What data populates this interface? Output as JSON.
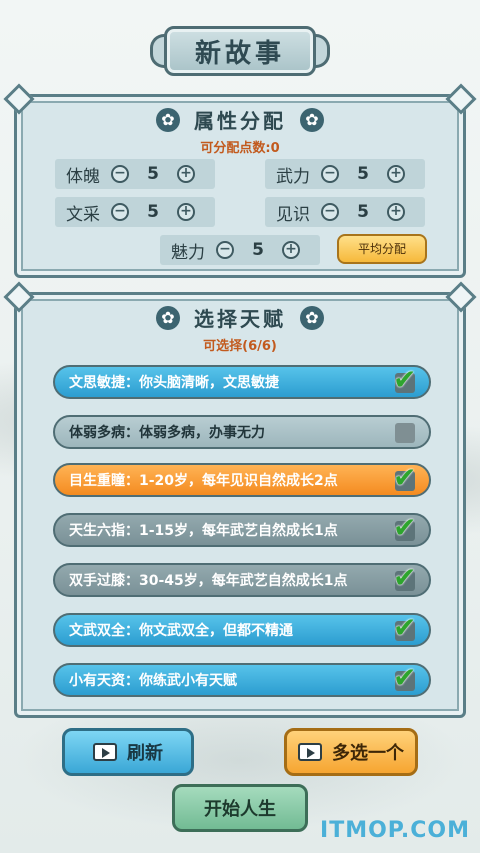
{
  "header": {
    "title": "新故事"
  },
  "attributes": {
    "title": "属性分配",
    "points_label": "可分配点数:0",
    "items": [
      {
        "name": "体魄",
        "value": "5"
      },
      {
        "name": "武力",
        "value": "5"
      },
      {
        "name": "文采",
        "value": "5"
      },
      {
        "name": "见识",
        "value": "5"
      },
      {
        "name": "魅力",
        "value": "5"
      }
    ],
    "minus_glyph": "−",
    "plus_glyph": "+",
    "average_button": "平均分配"
  },
  "talents": {
    "title": "选择天赋",
    "selectable_label": "可选择(6/6)",
    "items": [
      {
        "text": "文思敏捷：你头脑清晰，文思敏捷",
        "selected": true,
        "style": "blue"
      },
      {
        "text": "体弱多病：体弱多病，办事无力",
        "selected": false,
        "style": "gray"
      },
      {
        "text": "目生重瞳：1-20岁，每年见识自然成长2点",
        "selected": true,
        "style": "orange"
      },
      {
        "text": "天生六指：1-15岁，每年武艺自然成长1点",
        "selected": true,
        "style": "dark"
      },
      {
        "text": "双手过膝：30-45岁，每年武艺自然成长1点",
        "selected": true,
        "style": "dark"
      },
      {
        "text": "文武双全：你文武双全，但都不精通",
        "selected": true,
        "style": "blue"
      },
      {
        "text": "小有天资：你练武小有天赋",
        "selected": true,
        "style": "blue"
      }
    ]
  },
  "actions": {
    "refresh": "刷新",
    "more": "多选一个",
    "start": "开始人生"
  },
  "icons": {
    "flower": "flower-icon",
    "video": "video-icon",
    "check": "check-icon"
  },
  "watermark": "ITMOP.COM",
  "colors": {
    "accent_orange": "#f48b20",
    "talent_blue": "#2c9dd0",
    "points_text": "#c25a1e"
  }
}
